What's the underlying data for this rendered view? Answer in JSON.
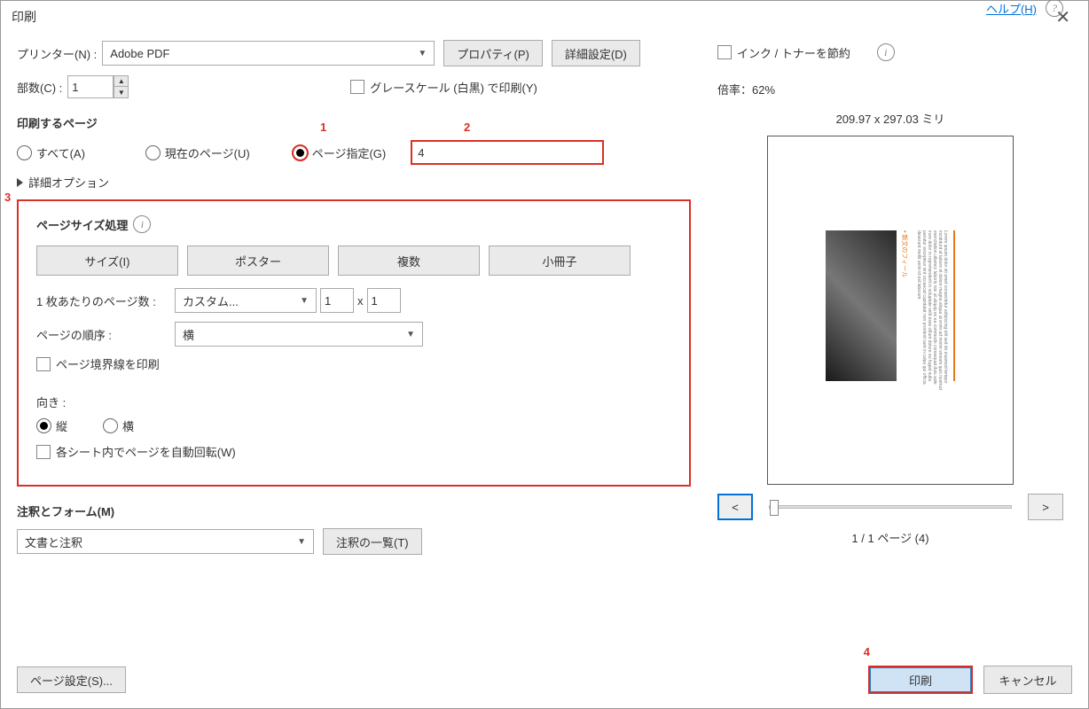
{
  "title": "印刷",
  "printer": {
    "label": "プリンター(N) :",
    "value": "Adobe PDF"
  },
  "buttons": {
    "properties": "プロパティ(P)",
    "advanced": "詳細設定(D)",
    "help": "ヘルプ(H)",
    "pageSetup": "ページ設定(S)...",
    "print": "印刷",
    "cancel": "キャンセル",
    "commentsList": "注釈の一覧(T)",
    "prev": "<",
    "next": ">"
  },
  "copies": {
    "label": "部数(C) :",
    "value": "1"
  },
  "grayscale": "グレースケール (白黒) で印刷(Y)",
  "saveInk": "インク / トナーを節約",
  "pagesSection": {
    "title": "印刷するページ",
    "all": "すべて(A)",
    "current": "現在のページ(U)",
    "range": "ページ指定(G)",
    "rangeValue": "4",
    "moreOptions": "詳細オプション"
  },
  "sizeSection": {
    "title": "ページサイズ処理",
    "tabs": {
      "size": "サイズ(I)",
      "poster": "ポスター",
      "multiple": "複数",
      "booklet": "小冊子"
    },
    "perSheet": {
      "label": "1 枚あたりのページ数 :",
      "value": "カスタム...",
      "x": "1",
      "y": "1",
      "times": "x"
    },
    "order": {
      "label": "ページの順序 :",
      "value": "横"
    },
    "border": "ページ境界線を印刷",
    "orient": {
      "label": "向き :",
      "portrait": "縦",
      "landscape": "横"
    },
    "autorotate": "各シート内でページを自動回転(W)"
  },
  "commentsSection": {
    "title": "注釈とフォーム(M)",
    "value": "文書と注釈"
  },
  "preview": {
    "scale": "倍率：62%",
    "dims": "209.97 x 297.03 ミリ",
    "pager": "1 / 1 ページ (4)"
  },
  "annotations": {
    "a1": "1",
    "a2": "2",
    "a3": "3",
    "a4": "4"
  }
}
